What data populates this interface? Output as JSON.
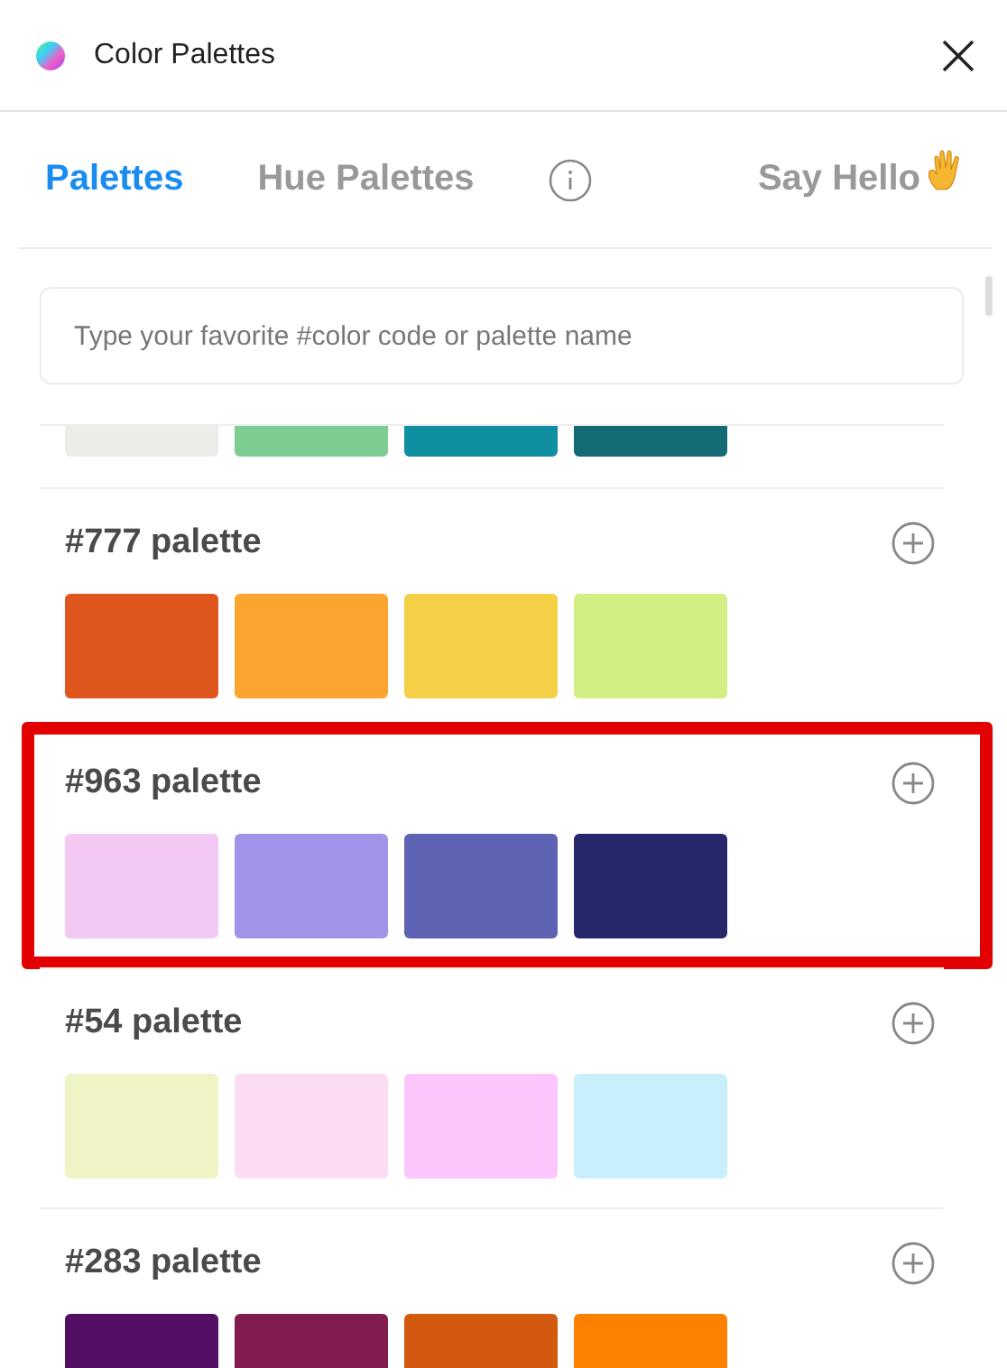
{
  "window": {
    "title": "Color Palettes"
  },
  "tabs": [
    {
      "label": "Palettes",
      "selected": true
    },
    {
      "label": "Hue Palettes",
      "selected": false
    }
  ],
  "say_hello": "Say Hello",
  "search": {
    "placeholder": "Type your favorite #color code or palette name"
  },
  "palettes": [
    {
      "kind": "partial",
      "highlighted": false,
      "swatches": [
        {
          "color": "#edece8"
        },
        {
          "color": "#7dcd93"
        },
        {
          "color": "#0f8fa0"
        },
        {
          "color": "#146b76"
        }
      ]
    },
    {
      "kind": "full",
      "name": "#777 palette",
      "highlighted": false,
      "swatches": [
        {
          "color": "#de561c"
        },
        {
          "color": "#fba530"
        },
        {
          "color": "#f4d046"
        },
        {
          "color": "#d2ef84"
        }
      ]
    },
    {
      "kind": "full",
      "name": "#963 palette",
      "highlighted": true,
      "swatches": [
        {
          "color": "#f3c8f3"
        },
        {
          "color": "#a393e8"
        },
        {
          "color": "#5f63b3"
        },
        {
          "color": "#27286b"
        }
      ]
    },
    {
      "kind": "full",
      "name": "#54 palette",
      "highlighted": false,
      "swatches": [
        {
          "color": "#f0f3c3"
        },
        {
          "color": "#fcdcf3"
        },
        {
          "color": "#fcc6fc"
        },
        {
          "color": "#c8f0fc"
        }
      ]
    },
    {
      "kind": "full",
      "name": "#283 palette",
      "highlighted": false,
      "swatches": [
        {
          "color": "#530f63"
        },
        {
          "color": "#811c4f"
        },
        {
          "color": "#d35911"
        },
        {
          "color": "#fe8000"
        }
      ]
    }
  ]
}
